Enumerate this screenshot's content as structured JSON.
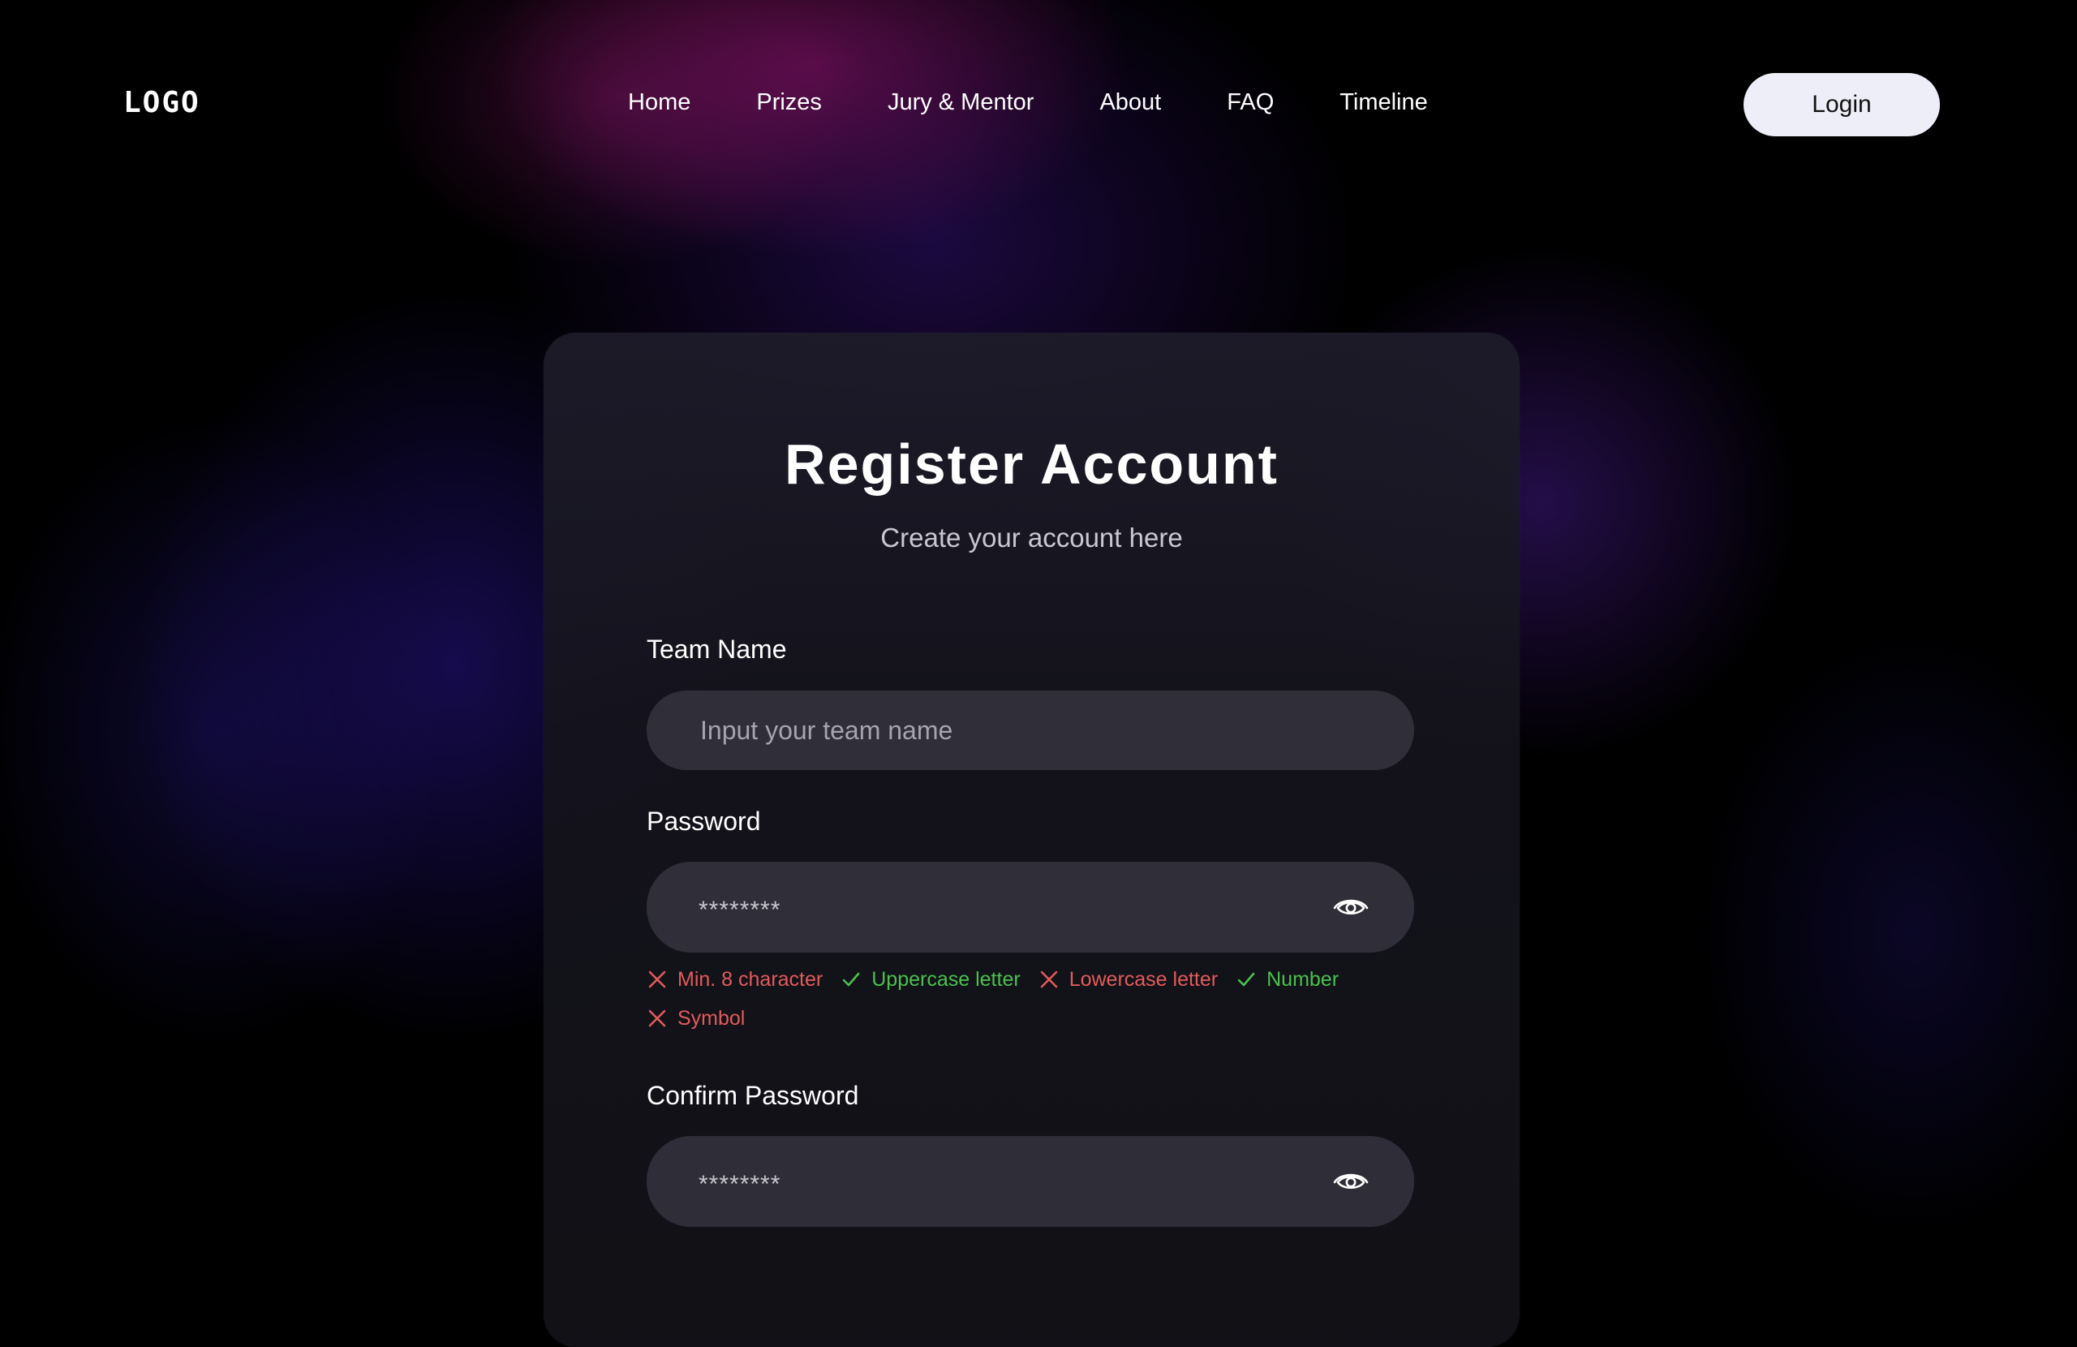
{
  "nav": {
    "logo": "LOGO",
    "items": [
      "Home",
      "Prizes",
      "Jury & Mentor",
      "About",
      "FAQ",
      "Timeline"
    ],
    "login_label": "Login"
  },
  "form": {
    "title": "Register Account",
    "subtitle": "Create your account here",
    "team_name": {
      "label": "Team Name",
      "placeholder": "Input your team name",
      "value": ""
    },
    "password": {
      "label": "Password",
      "value_masked": "********"
    },
    "password_rules": [
      {
        "text": "Min. 8 character",
        "status": "fail"
      },
      {
        "text": "Uppercase letter",
        "status": "pass"
      },
      {
        "text": "Lowercase letter",
        "status": "fail"
      },
      {
        "text": "Number",
        "status": "pass"
      },
      {
        "text": "Symbol",
        "status": "fail"
      }
    ],
    "confirm_password": {
      "label": "Confirm  Password",
      "value_masked": "********"
    }
  },
  "icons": {
    "show_password": "eye-icon",
    "rule_fail": "x-icon",
    "rule_pass": "check-icon"
  },
  "colors": {
    "fail": "#E35B5B",
    "pass": "#49C24C",
    "login_button_bg": "#EEEEF8"
  }
}
